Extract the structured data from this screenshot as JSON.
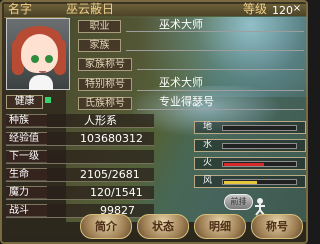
{
  "header": {
    "title_label": "名字",
    "name": "巫云蔽日",
    "level_label": "等级",
    "level": "120"
  },
  "profile": {
    "job_label": "职业",
    "job": "巫术大师",
    "family_label": "家族",
    "family_value": "",
    "family_title_label": "家族称号",
    "family_title_value": "",
    "special_title_label": "特别称号",
    "special_title": "巫术大师",
    "clan_title_label": "氏族称号",
    "clan_title": "专业得瑟号",
    "health_label": "健康"
  },
  "stats": [
    {
      "label": "种族",
      "value": "人形系"
    },
    {
      "label": "经验值",
      "value": "103680312"
    },
    {
      "label": "下一级",
      "value": ""
    },
    {
      "label": "生命",
      "value": "2105/2681"
    },
    {
      "label": "魔力",
      "value": "120/1541"
    },
    {
      "label": "战斗",
      "value": "99827"
    }
  ],
  "elements": [
    {
      "name": "地",
      "fill_percent": 0,
      "color": "#7e7e7e"
    },
    {
      "name": "水",
      "fill_percent": 0,
      "color": "#4d95d3"
    },
    {
      "name": "火",
      "fill_percent": 55,
      "color": "#d52a2a"
    },
    {
      "name": "风",
      "fill_percent": 45,
      "color": "#e7c63f"
    }
  ],
  "actions": {
    "arrange": "前排",
    "intro": "简介",
    "status": "状态",
    "detail": "明细",
    "title": "称号"
  },
  "icons": [
    "portrait-avatar",
    "green-health-icon",
    "character-figure-icon",
    "close-icon"
  ]
}
